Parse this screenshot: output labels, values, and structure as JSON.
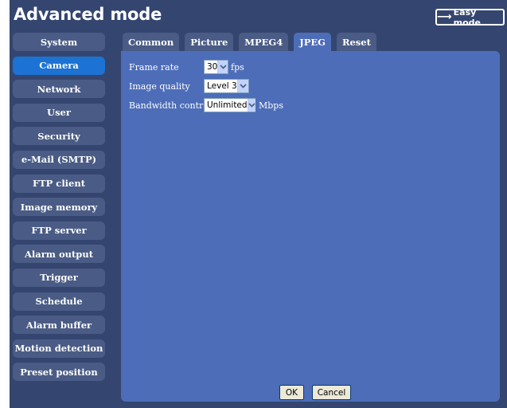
{
  "header": {
    "title": "Advanced mode",
    "easy_mode_label": "Easy mode"
  },
  "sidebar": {
    "items": [
      {
        "label": "System",
        "active": false
      },
      {
        "label": "Camera",
        "active": true
      },
      {
        "label": "Network",
        "active": false
      },
      {
        "label": "User",
        "active": false
      },
      {
        "label": "Security",
        "active": false
      },
      {
        "label": "e-Mail (SMTP)",
        "active": false
      },
      {
        "label": "FTP client",
        "active": false
      },
      {
        "label": "Image memory",
        "active": false
      },
      {
        "label": "FTP server",
        "active": false
      },
      {
        "label": "Alarm output",
        "active": false
      },
      {
        "label": "Trigger",
        "active": false
      },
      {
        "label": "Schedule",
        "active": false
      },
      {
        "label": "Alarm buffer",
        "active": false
      },
      {
        "label": "Motion detection",
        "active": false
      },
      {
        "label": "Preset position",
        "active": false
      }
    ]
  },
  "tabs": [
    {
      "label": "Common",
      "active": false
    },
    {
      "label": "Picture",
      "active": false
    },
    {
      "label": "MPEG4",
      "active": false
    },
    {
      "label": "JPEG",
      "active": true
    },
    {
      "label": "Reset",
      "active": false
    }
  ],
  "form": {
    "frame_rate": {
      "label": "Frame rate",
      "value": "30",
      "unit": "fps"
    },
    "image_quality": {
      "label": "Image quality",
      "value": "Level 3"
    },
    "bandwidth_control": {
      "label": "Bandwidth control",
      "value": "Unlimited",
      "unit": "Mbps"
    }
  },
  "buttons": {
    "ok_label": "OK",
    "cancel_label": "Cancel"
  },
  "colors": {
    "frame_bg": "#34466f",
    "panel_bg": "#4d6db8",
    "active_item": "#1c73d3",
    "inactive_item": "#4a5c85"
  }
}
